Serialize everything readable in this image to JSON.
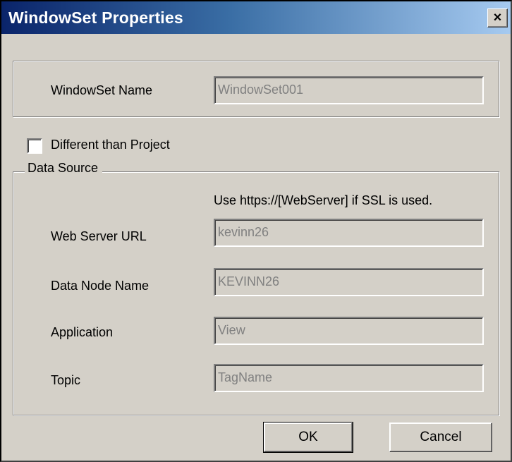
{
  "window": {
    "title": "WindowSet Properties",
    "close_glyph": "×"
  },
  "windowset": {
    "name_label": "WindowSet Name",
    "name_value": "WindowSet001"
  },
  "different_than_project": {
    "label": "Different than Project",
    "checked": false
  },
  "data_source": {
    "legend": "Data Source",
    "hint": "Use https://[WebServer] if SSL is used.",
    "fields": [
      {
        "label": "Web Server URL",
        "value": "kevinn26"
      },
      {
        "label": "Data Node Name",
        "value": "KEVINN26"
      },
      {
        "label": "Application",
        "value": "View"
      },
      {
        "label": "Topic",
        "value": "TagName"
      }
    ]
  },
  "buttons": {
    "ok": "OK",
    "cancel": "Cancel"
  },
  "colors": {
    "dialog_face": "#d4d0c8",
    "title_start": "#0a246a",
    "title_end": "#a6caf0",
    "disabled_text": "#808080"
  }
}
